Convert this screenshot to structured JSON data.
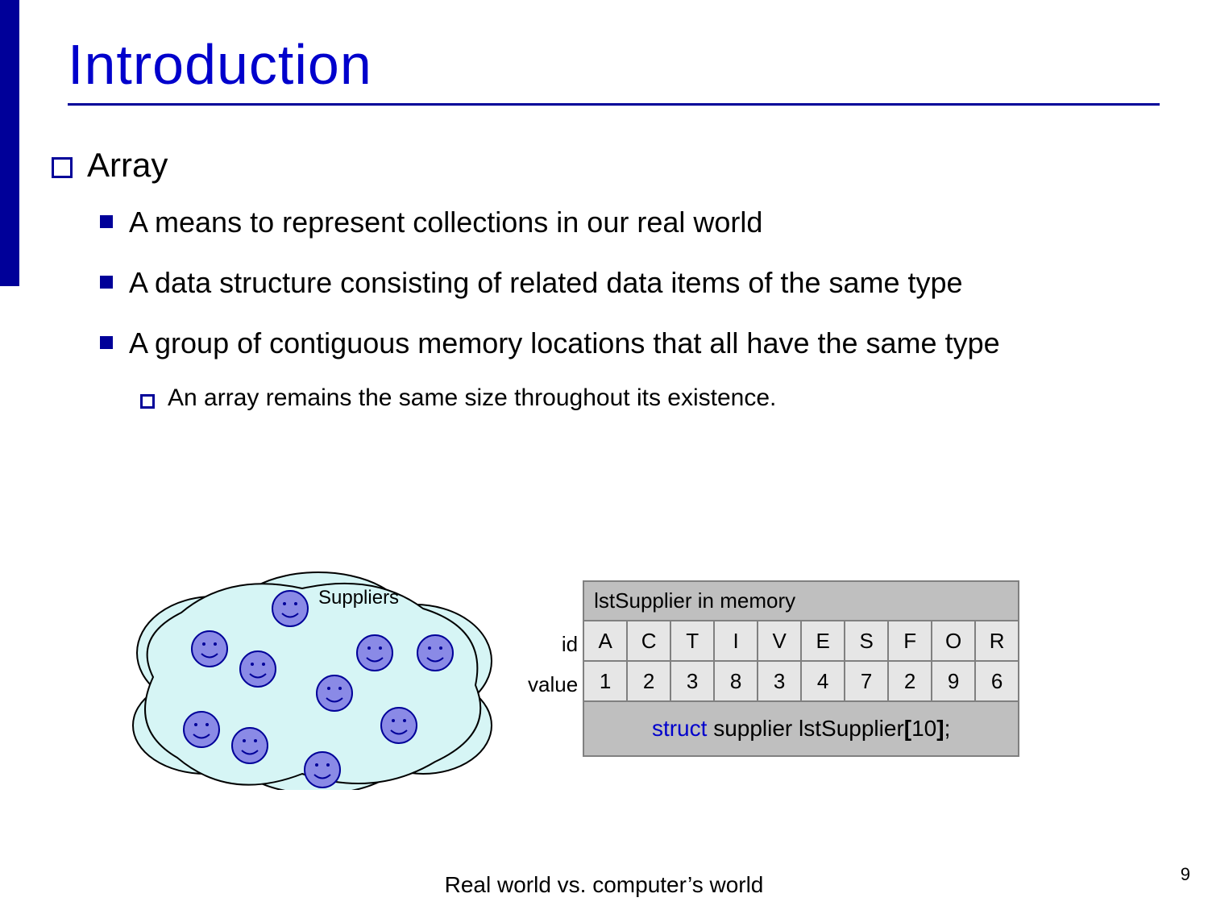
{
  "title": "Introduction",
  "bullets": {
    "lvl1": "Array",
    "lvl2": [
      "A means to represent collections in our real world",
      "A data structure consisting of related data items of the same type",
      "A group of contiguous memory locations that all have the same type"
    ],
    "lvl3": "An array remains the same size throughout its existence."
  },
  "cloud_label": "Suppliers",
  "memory": {
    "header": "lstSupplier in memory",
    "row_labels": {
      "id": "id",
      "value": "value"
    },
    "id": [
      "A",
      "C",
      "T",
      "I",
      "V",
      "E",
      "S",
      "F",
      "O",
      "R"
    ],
    "value": [
      "1",
      "2",
      "3",
      "8",
      "3",
      "4",
      "7",
      "2",
      "9",
      "6"
    ],
    "decl": {
      "kw": "struct",
      "mid": " supplier lstSupplier",
      "lb": "[",
      "n": "10",
      "rb": "]",
      "semi": ";"
    }
  },
  "caption": "Real world vs. computer’s world",
  "page_number": "9",
  "chart_data": {
    "type": "table",
    "title": "lstSupplier in memory",
    "columns": [
      "A",
      "C",
      "T",
      "I",
      "V",
      "E",
      "S",
      "F",
      "O",
      "R"
    ],
    "rows": [
      {
        "name": "id",
        "values": [
          "A",
          "C",
          "T",
          "I",
          "V",
          "E",
          "S",
          "F",
          "O",
          "R"
        ]
      },
      {
        "name": "value",
        "values": [
          1,
          2,
          3,
          8,
          3,
          4,
          7,
          2,
          9,
          6
        ]
      }
    ],
    "declaration": "struct supplier lstSupplier[10];"
  }
}
